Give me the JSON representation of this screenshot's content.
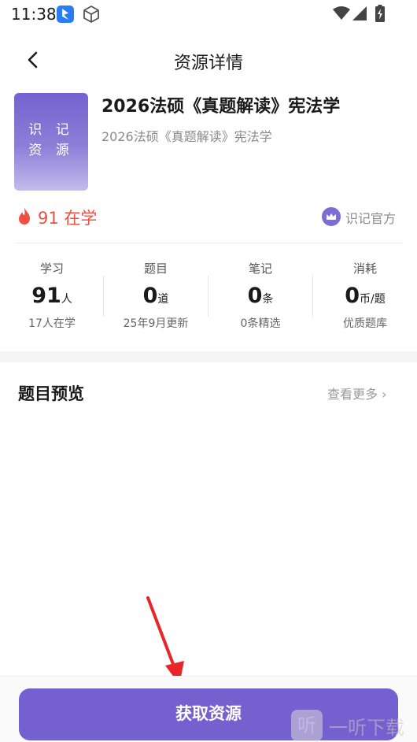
{
  "status_bar": {
    "time": "11:38"
  },
  "nav": {
    "title": "资源详情"
  },
  "resource": {
    "cover_text_line1": "识 记",
    "cover_text_line2": "资 源",
    "title": "2026法硕《真题解读》宪法学",
    "subtitle": "2026法硕《真题解读》宪法学",
    "study_count": "91 在学",
    "official_label": "识记官方"
  },
  "stats": [
    {
      "label": "学习",
      "value": "91",
      "unit": "人",
      "sub": "17人在学"
    },
    {
      "label": "题目",
      "value": "0",
      "unit": "道",
      "sub": "25年9月更新"
    },
    {
      "label": "笔记",
      "value": "0",
      "unit": "条",
      "sub": "0条精选"
    },
    {
      "label": "消耗",
      "value": "0",
      "unit": "币/题",
      "sub": "优质题库"
    }
  ],
  "preview": {
    "title": "题目预览",
    "more_label": "查看更多 ›"
  },
  "action": {
    "button_label": "获取资源"
  },
  "watermark": {
    "logo_glyph": "听",
    "text": "一听下载"
  },
  "colors": {
    "accent": "#7460cf",
    "hot": "#f04f43"
  }
}
